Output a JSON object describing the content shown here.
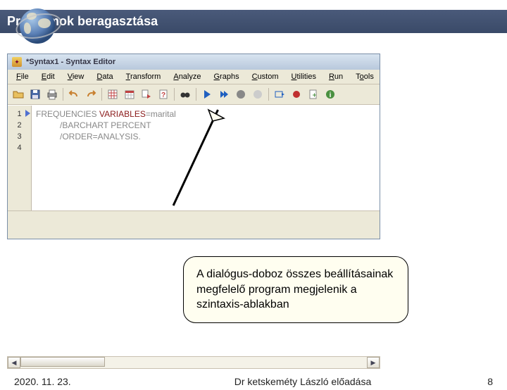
{
  "slide": {
    "title": "Programok beragasztása"
  },
  "window": {
    "title": "*Syntax1 - Syntax Editor",
    "menu": [
      {
        "pre": "",
        "ul": "F",
        "post": "ile"
      },
      {
        "pre": "",
        "ul": "E",
        "post": "dit"
      },
      {
        "pre": "",
        "ul": "V",
        "post": "iew"
      },
      {
        "pre": "",
        "ul": "D",
        "post": "ata"
      },
      {
        "pre": "",
        "ul": "T",
        "post": "ransform"
      },
      {
        "pre": "",
        "ul": "A",
        "post": "nalyze"
      },
      {
        "pre": "",
        "ul": "G",
        "post": "raphs"
      },
      {
        "pre": "",
        "ul": "C",
        "post": "ustom"
      },
      {
        "pre": "",
        "ul": "U",
        "post": "tilities"
      },
      {
        "pre": "",
        "ul": "R",
        "post": "un"
      },
      {
        "pre": "T",
        "ul": "o",
        "post": "ols"
      }
    ],
    "gutter": [
      "1",
      "2",
      "3",
      "4"
    ],
    "code": {
      "line1_cmd": "FREQUENCIES ",
      "line1_kw": "VARIABLES",
      "line1_rest": "=marital",
      "line2": "/BARCHART PERCENT",
      "line3": "/ORDER=ANALYSIS."
    }
  },
  "callout": {
    "text": "A dialógus-doboz összes beállításainak megfelelő program megjelenik a szintaxis-ablakban"
  },
  "footer": {
    "date": "2020. 11. 23.",
    "center": "Dr ketskeméty László előadása",
    "page": "8"
  },
  "icons": {
    "open": "open-icon",
    "save": "save-icon",
    "print": "print-icon",
    "undo": "undo-icon",
    "redo": "redo-icon",
    "grid": "data-grid-icon",
    "calendar": "calendar-icon",
    "export": "export-icon",
    "help": "help-icon",
    "binoc": "binoculars-icon",
    "run": "run-icon",
    "runall": "run-all-icon",
    "stop": "stop-icon",
    "stop2": "stop-dim-icon",
    "goto": "goto-icon",
    "bkpt": "breakpoint-icon",
    "new": "new-file-icon",
    "info": "info-icon"
  }
}
